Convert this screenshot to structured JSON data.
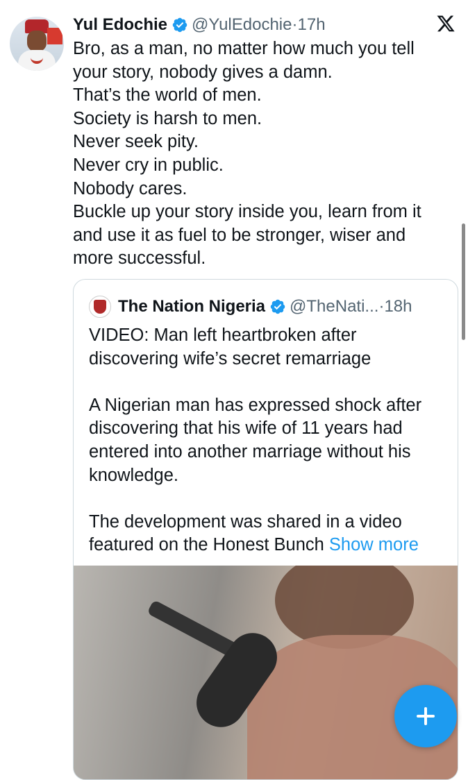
{
  "tweet": {
    "author_name": "Yul Edochie",
    "handle": "@YulEdochie",
    "time": "17h",
    "text_lines": [
      "Bro, as a man, no matter how much you tell",
      "your story, nobody gives a damn.",
      "That’s the world of men.",
      "Society is harsh to men.",
      "Never seek pity.",
      "Never cry in public.",
      "Nobody cares.",
      "Buckle up your story inside you, learn from it",
      "and use it as fuel to be stronger, wiser and",
      "more successful."
    ]
  },
  "quote": {
    "author_name": "The Nation Nigeria",
    "handle": "@TheNati...",
    "time": "18h",
    "text_lines": [
      "VIDEO: Man left heartbroken after",
      "discovering wife’s secret remarriage",
      "",
      "A Nigerian man has expressed shock after",
      "discovering that his wife of 11 years had",
      "entered into another marriage without his",
      "knowledge.",
      "",
      "The development was shared in a video"
    ],
    "last_line": "featured on the Honest Bunch",
    "show_more": "Show more"
  },
  "separator": "·",
  "colors": {
    "accent": "#1d9bf0",
    "text": "#0f1419",
    "secondary": "#536471",
    "border": "#cfd9de"
  },
  "icons": {
    "close": "x-logo-icon",
    "verified": "verified-badge-icon",
    "compose": "plus-icon"
  }
}
